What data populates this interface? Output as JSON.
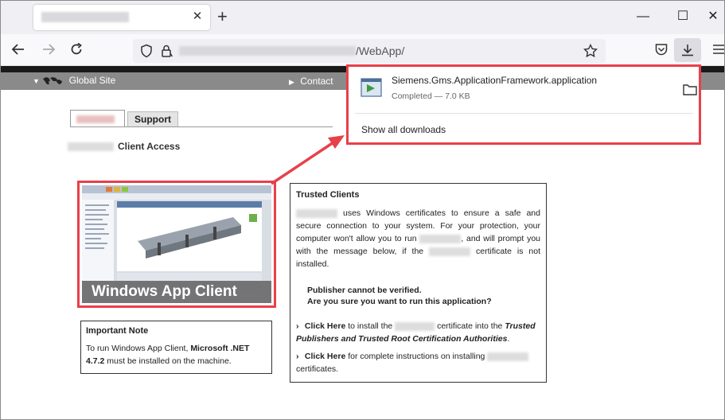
{
  "browser": {
    "new_tab_symbol": "+",
    "window_controls": {
      "minimize": "—",
      "maximize": "☐",
      "close": "✕"
    },
    "tab_close": "✕",
    "url_suffix": "/WebApp/"
  },
  "site": {
    "global_site": "Global Site",
    "contact": "Contact",
    "tab_support": "Support",
    "client_access": "Client Access"
  },
  "app_image": {
    "caption": "Windows App Client"
  },
  "important_note": {
    "title": "Important Note",
    "text_prefix": "To run Windows App Client, ",
    "text_bold": "Microsoft .NET 4.7.2",
    "text_suffix": " must be installed on the machine."
  },
  "trusted_clients": {
    "title": "Trusted Clients",
    "para_part1": "uses Windows certificates to ensure a safe and secure connection to your system. For your protection, your computer won't allow you to run",
    "para_part2": ", and will prompt you with the message below, if the",
    "para_part3": "certificate is not installed.",
    "publisher_line1": "Publisher cannot be verified.",
    "publisher_line2": "Are you sure you want to run this application?",
    "click1_link": "Click Here",
    "click1_text_a": " to install the ",
    "click1_text_b": " certificate into the ",
    "click1_italic": "Trusted Publishers and Trusted Root Certification Authorities",
    "click1_end": ".",
    "click2_link": "Click Here",
    "click2_text": " for complete instructions on installing ",
    "click2_end": "certificates."
  },
  "downloads": {
    "filename": "Siemens.Gms.ApplicationFramework.application",
    "status": "Completed — 7.0 KB",
    "show_all": "Show all downloads"
  },
  "colors": {
    "highlight": "#e8404a",
    "gray_bar": "#8a8a8a"
  }
}
